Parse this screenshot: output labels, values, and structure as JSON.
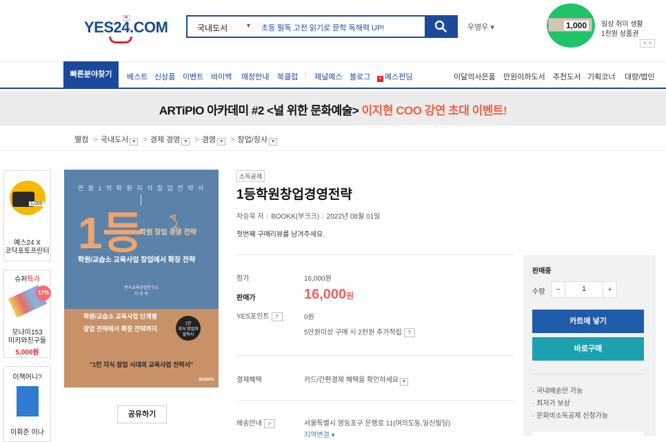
{
  "header": {
    "logo_text": "YES24.COM",
    "search_category": "국내도서",
    "search_placeholder": "초등 필독 고전 읽기로 문학 독해력 UP!",
    "user_label": "우영우 ▾",
    "promo_amount": "1,000",
    "promo_line1": "일상 취미 생활",
    "promo_line2": "1천원 상품권",
    "promo_nav": "< >"
  },
  "nav": {
    "quick": "빠른분야찾기",
    "left": [
      "베스트",
      "신상품",
      "이벤트",
      "바이백",
      "매장안내",
      "북클럽",
      "채널예스",
      "블로그",
      "예스펀딩"
    ],
    "right": [
      "이달의사은품",
      "만원이하도서",
      "추천도서",
      "기획코너",
      "대량/법인"
    ]
  },
  "banner": {
    "part1": "ARTiPIO 아카데미 #2 <널 위한 문화예술> ",
    "part2": "이지현 COO 강연 초대 이벤트!"
  },
  "breadcrumb": [
    "웰컴",
    "국내도서",
    "경제 경영",
    "경영",
    "창업/장사"
  ],
  "ads": [
    {
      "name": "예스24 X 코닥포토프린터",
      "line1": "예스24 X",
      "line2": "코닥포토프린터",
      "amount": "1,000"
    },
    {
      "title": "슈퍼특가",
      "discount": "17%",
      "line1": "모나미153",
      "line2": "미키와친구들",
      "price": "5,000원"
    },
    {
      "title": "이책어니?",
      "line1": "이휘준 이나"
    }
  ],
  "cover": {
    "top": "연 봉 1 억 학 원 지 식 창 업 전 략 서",
    "big": "1등",
    "sub1": "학원 창업 경영 전략",
    "sub2": "학원/교습소 교육사업 창업에서 확장 전략",
    "publisher_small": "한국교육산업연구소\n차 승 욱",
    "lower1": "학원/교습소 교육사업 단계별",
    "lower2": "창업 전략에서 확장 전략까지",
    "badge": "1인\n지식 창업자\n필독서",
    "quote": "\"1인 지식 창업 시대의 교육사업 전략서\"",
    "brand": "BOOKK"
  },
  "share_label": "공유하기",
  "product": {
    "tag": "소득공제",
    "title": "1등학원창업경영전략",
    "author": "차승욱 저",
    "publisher": "BOOKK(부크크)",
    "date": "2022년 08월 01일",
    "review": "첫번째 구매리뷰를 남겨주세요."
  },
  "pricing": {
    "list_label": "정가",
    "list_price": "16,000원",
    "sale_label": "판매가",
    "sale_price": "16,000",
    "sale_unit": "원",
    "point_label": "YES포인트",
    "point_value": "0원",
    "point_note": "5만원이상 구매 시 2천원 추가적립",
    "pay_label": "결제혜택",
    "pay_value": "카드/간편결제 혜택을 확인하세요",
    "ship_label": "배송안내",
    "ship_value": "서울특별시 영등포구 은행로 11(여의도동,일신빌딩)",
    "ship_change": "지역변경 ▾"
  },
  "panel": {
    "status": "판매중",
    "qty_label": "수량",
    "qty": "1",
    "cart": "카트에 넣기",
    "buy": "바로구매",
    "notes": [
      "· 국내배송만 가능",
      "· 최저가 보상",
      "· 문화비소득공제 신청가능"
    ]
  },
  "colors": {
    "brand_blue": "#1b4a9a",
    "sale_red": "#f0605a",
    "cart_blue": "#1f5ba8",
    "buy_teal": "#1da0b0",
    "banner_highlight": "#f06042"
  }
}
